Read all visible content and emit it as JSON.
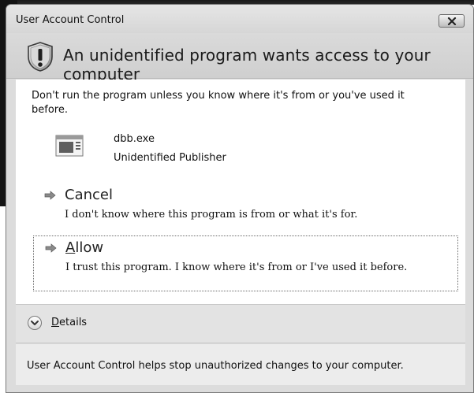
{
  "window": {
    "title": "User Account Control",
    "close_icon": "close-icon"
  },
  "header": {
    "icon": "shield-icon",
    "text": "An unidentified program wants access to your computer"
  },
  "content": {
    "warning": "Don't run the program unless you know where it's from or you've used it before.",
    "program": {
      "icon": "program-icon",
      "name": "dbb.exe",
      "publisher": "Unidentified Publisher"
    },
    "options": [
      {
        "title": "Cancel",
        "description": "I don't know where this program is from or what it's for.",
        "icon": "arrow-right-icon"
      },
      {
        "title_prefix": "A",
        "title_rest": "llow",
        "description": "I trust this program. I know where it's from or I've used it before.",
        "icon": "arrow-right-icon"
      }
    ]
  },
  "details": {
    "label_prefix": "D",
    "label_rest": "etails",
    "icon": "chevron-down-icon"
  },
  "footer": {
    "text": "User Account Control helps stop unauthorized changes to your computer."
  }
}
